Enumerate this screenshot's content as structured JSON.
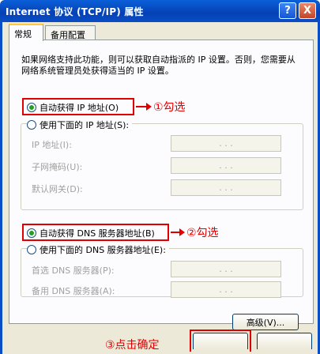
{
  "window": {
    "title": "Internet 协议 (TCP/IP) 属性",
    "help_label": "?",
    "close_label": "X"
  },
  "tabs": [
    {
      "label": "常规"
    },
    {
      "label": "备用配置"
    }
  ],
  "description": "如果网络支持此功能，则可以获取自动指派的 IP 设置。否则，您需要从网络系统管理员处获得适当的 IP 设置。",
  "ip_section": {
    "auto_option": {
      "label": "自动获得 IP 地址(O)",
      "selected": true
    },
    "manual_option": {
      "label": "使用下面的 IP 地址(S):",
      "selected": false
    },
    "fields": [
      {
        "label": "IP 地址(I):",
        "value": ". . ."
      },
      {
        "label": "子网掩码(U):",
        "value": ". . ."
      },
      {
        "label": "默认网关(D):",
        "value": ". . ."
      }
    ]
  },
  "dns_section": {
    "auto_option": {
      "label": "自动获得 DNS 服务器地址(B)",
      "selected": true
    },
    "manual_option": {
      "label": "使用下面的 DNS 服务器地址(E):",
      "selected": false
    },
    "fields": [
      {
        "label": "首选 DNS 服务器(P):",
        "value": ". . ."
      },
      {
        "label": "备用 DNS 服务器(A):",
        "value": ". . ."
      }
    ]
  },
  "advanced_button": "高级(V)...",
  "annotations": {
    "step1": "①勾选",
    "step2": "②勾选",
    "step3": "③点击确定"
  },
  "colors": {
    "annotation": "#e00000",
    "titlebar": "#0a4ec6",
    "dialog_bg": "#ece9d8"
  }
}
